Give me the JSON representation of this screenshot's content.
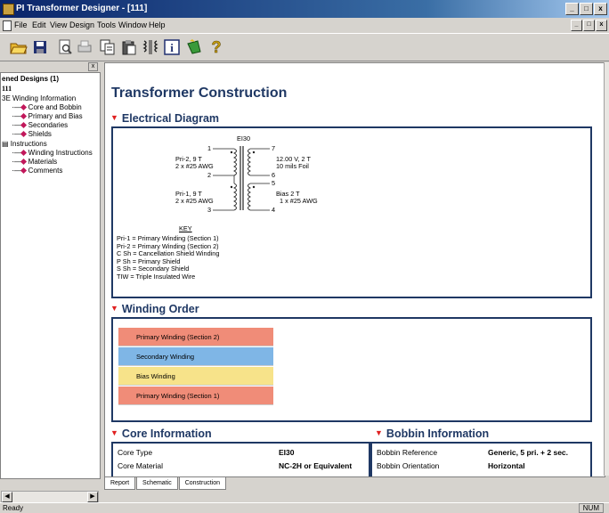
{
  "window": {
    "title": "PI Transformer Designer - [111]",
    "btn_min": "_",
    "btn_max": "□",
    "btn_close": "x"
  },
  "menu": [
    "File",
    "Edit",
    "View",
    "Design",
    "Tools",
    "Window",
    "Help"
  ],
  "tree": {
    "header": "ened Designs (1)",
    "root": "111",
    "items": [
      {
        "label": "Winding Information",
        "level": 1,
        "icon": "none"
      },
      {
        "label": "Core and Bobbin",
        "level": 2,
        "icon": "diamond"
      },
      {
        "label": "Primary and Bias",
        "level": 2,
        "icon": "diamond"
      },
      {
        "label": "Secondaries",
        "level": 2,
        "icon": "diamond"
      },
      {
        "label": "Shields",
        "level": 2,
        "icon": "diamond"
      },
      {
        "label": "Instructions",
        "level": 1,
        "icon": "none"
      },
      {
        "label": "Winding Instructions",
        "level": 2,
        "icon": "diamond"
      },
      {
        "label": "Materials",
        "level": 2,
        "icon": "diamond"
      },
      {
        "label": "Comments",
        "level": 2,
        "icon": "diamond"
      }
    ],
    "scroll_left": "◀",
    "scroll_right": "▶"
  },
  "content": {
    "page_title": "Transformer Construction",
    "electrical": {
      "title": "Electrical Diagram",
      "core_label": "EI30",
      "pin1": "1",
      "pin2": "2",
      "pin3": "3",
      "pin4": "4",
      "pin5": "5",
      "pin6": "6",
      "pin7": "7",
      "pri2_label": "Pri-2,  9 T",
      "pri2_wire": "2 x #25 AWG",
      "pri1_label": "Pri-1,  9 T",
      "pri1_wire": "2 x #25 AWG",
      "sec_label": "12.00 V,  2 T",
      "sec_wire": "10 mils Foil",
      "bias_label": "Bias  2 T",
      "bias_wire": "1 x #25 AWG",
      "key_title": "KEY",
      "key": [
        "Pri-1 = Primary Winding (Section 1)",
        "Pri-2 = Primary Winding (Section 2)",
        "C Sh = Cancellation Shield Winding",
        "P Sh = Primary Shield",
        "S Sh = Secondary Shield",
        "TIW = Triple Insulated Wire"
      ]
    },
    "winding_order": {
      "title": "Winding Order",
      "items": [
        {
          "label": "Primary Winding (Section 2)",
          "color": "#f08c78"
        },
        {
          "label": "Secondary Winding",
          "color": "#7fb6e6"
        },
        {
          "label": "Bias Winding",
          "color": "#f7e38a"
        },
        {
          "label": "Primary Winding (Section 1)",
          "color": "#f08c78"
        }
      ]
    },
    "core_info": {
      "title": "Core Information",
      "rows": [
        {
          "label": "Core Type",
          "value": "EI30"
        },
        {
          "label": "Core Material",
          "value": "NC-2H or Equivalent"
        }
      ]
    },
    "bobbin_info": {
      "title": "Bobbin Information",
      "rows": [
        {
          "label": "Bobbin Reference",
          "value": "Generic, 5 pri. + 2 sec."
        },
        {
          "label": "Bobbin Orientation",
          "value": "Horizontal"
        }
      ]
    }
  },
  "tabs": [
    "Report",
    "Schematic",
    "Construction"
  ],
  "status": {
    "left": "Ready",
    "right": "NUM"
  },
  "colors": {
    "accent": "#1f3864",
    "marker": "#e02020"
  }
}
